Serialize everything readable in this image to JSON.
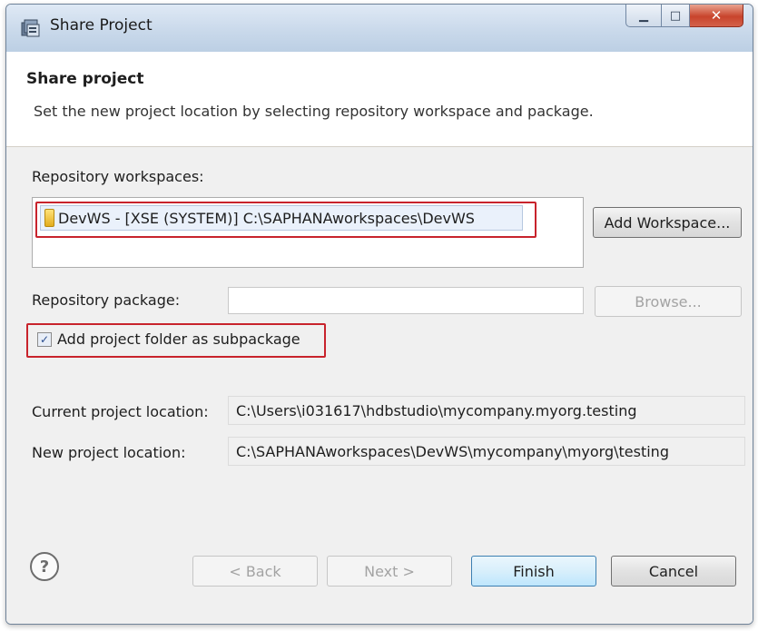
{
  "window": {
    "title": "Share Project",
    "minimize_glyph": "▁",
    "maximize_glyph": "□",
    "close_glyph": "✕"
  },
  "header": {
    "title": "Share project",
    "description": "Set the new project location by selecting repository workspace and package."
  },
  "workspaces": {
    "label": "Repository workspaces:",
    "items": [
      "DevWS - [XSE (SYSTEM)] C:\\SAPHANAworkspaces\\DevWS"
    ],
    "add_button": "Add Workspace..."
  },
  "package": {
    "label": "Repository package:",
    "value": "",
    "browse_button": "Browse..."
  },
  "subpackage": {
    "label": "Add project folder as subpackage",
    "checked": true,
    "check_glyph": "✓"
  },
  "current_location": {
    "label": "Current project location:",
    "value": "C:\\Users\\i031617\\hdbstudio\\mycompany.myorg.testing"
  },
  "new_location": {
    "label": "New project location:",
    "value": "C:\\SAPHANAworkspaces\\DevWS\\mycompany\\myorg\\testing"
  },
  "footer": {
    "help_glyph": "?",
    "back": "< Back",
    "next": "Next >",
    "finish": "Finish",
    "cancel": "Cancel"
  },
  "colors": {
    "highlight": "#c8232c",
    "titlebar": "#c8d8ea",
    "dialog_bg": "#f0f0f0"
  },
  "icons": {
    "title": "share-project-icon",
    "workspace": "workspace-icon",
    "help": "help-icon"
  }
}
